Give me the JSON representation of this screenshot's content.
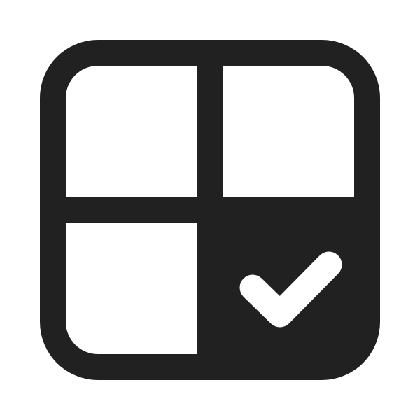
{
  "icon": {
    "name": "grid-checkmark-icon",
    "color": "#212121",
    "background": "#ffffff",
    "checked_cell": "bottom-right"
  }
}
